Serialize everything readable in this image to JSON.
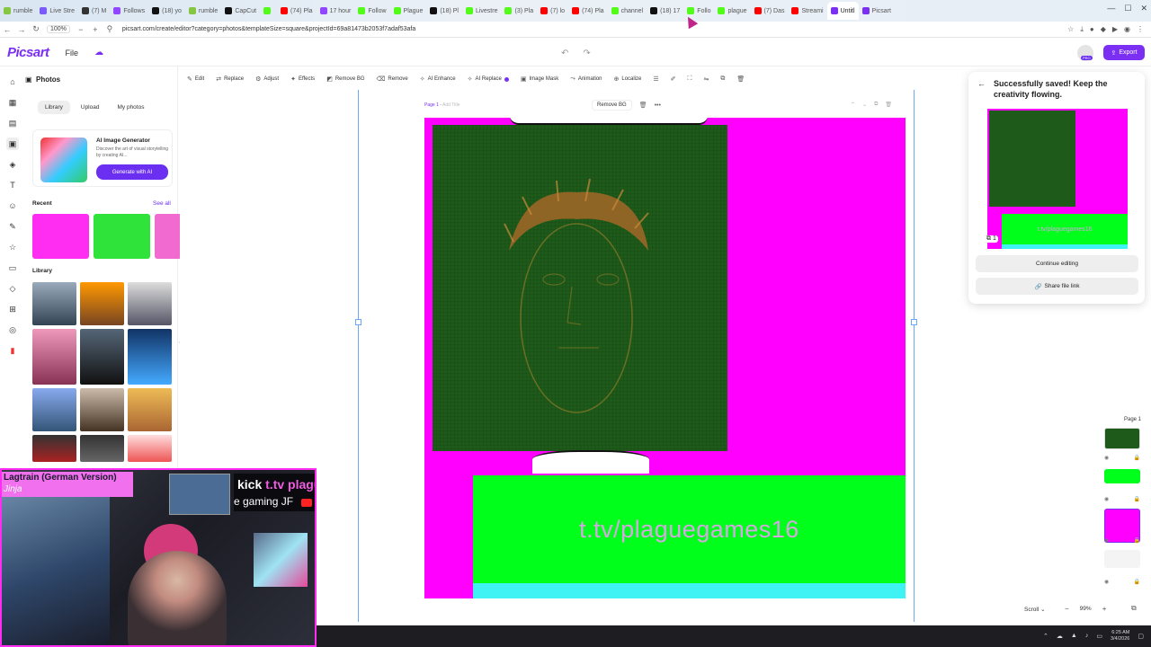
{
  "browser": {
    "tabs": [
      {
        "label": "rumble",
        "color": "#85c742"
      },
      {
        "label": "Live Stre",
        "color": "#7a5af8"
      },
      {
        "label": "(7) M",
        "color": "#333"
      },
      {
        "label": "Follows",
        "color": "#9146ff"
      },
      {
        "label": "(18) yo",
        "color": "#111"
      },
      {
        "label": "rumble",
        "color": "#85c742"
      },
      {
        "label": "CapCut",
        "color": "#111"
      },
      {
        "label": "",
        "color": "#53fc18"
      },
      {
        "label": "(74) Pla",
        "color": "#ff0000"
      },
      {
        "label": "17 hour",
        "color": "#9146ff"
      },
      {
        "label": "Follow",
        "color": "#53fc18"
      },
      {
        "label": "Plague",
        "color": "#53fc18"
      },
      {
        "label": "(18) Pl",
        "color": "#111"
      },
      {
        "label": "Livestre",
        "color": "#53fc18"
      },
      {
        "label": "(3) Pla",
        "color": "#53fc18"
      },
      {
        "label": "(7) lo",
        "color": "#ff0000"
      },
      {
        "label": "(74) Pla",
        "color": "#ff0000"
      },
      {
        "label": "channel",
        "color": "#53fc18"
      },
      {
        "label": "(18) 17",
        "color": "#111"
      },
      {
        "label": "Follo",
        "color": "#53fc18"
      },
      {
        "label": "plague",
        "color": "#53fc18"
      },
      {
        "label": "(7) Das",
        "color": "#ff0000"
      },
      {
        "label": "Streami",
        "color": "#ff0000"
      },
      {
        "label": "Untitl",
        "color": "#7b2ff2",
        "active": true
      },
      {
        "label": "Picsart",
        "color": "#7b2ff2"
      }
    ],
    "zoom": "100%",
    "url": "picsart.com/create/editor?category=photos&templateSize=square&projectId=69a81473b2053f7adaf53afa"
  },
  "app": {
    "logo": "Picsart",
    "file_menu": "File",
    "export_label": "Export",
    "pro_label": "PRO"
  },
  "panel": {
    "title": "Photos",
    "tabs": [
      "Library",
      "Upload",
      "My photos"
    ],
    "ai_card": {
      "title": "AI Image Generator",
      "desc": "Discover the art of visual storytelling by creating AI...",
      "button": "Generate with AI"
    },
    "recent_label": "Recent",
    "see_all": "See all",
    "library_label": "Library"
  },
  "toolbar": {
    "items": [
      {
        "label": "Edit",
        "icon": "edit-icon"
      },
      {
        "label": "Replace",
        "icon": "replace-icon"
      },
      {
        "label": "Adjust",
        "icon": "adjust-icon"
      },
      {
        "label": "Effects",
        "icon": "effects-icon"
      },
      {
        "label": "Remove BG",
        "icon": "remove-bg-icon"
      },
      {
        "label": "Remove",
        "icon": "remove-icon"
      },
      {
        "label": "AI Enhance",
        "icon": "ai-enhance-icon"
      },
      {
        "label": "AI Replace",
        "icon": "ai-replace-icon"
      },
      {
        "label": "Image Mask",
        "icon": "image-mask-icon"
      },
      {
        "label": "Animation",
        "icon": "animation-icon"
      },
      {
        "label": "Localize",
        "icon": "localize-icon"
      }
    ]
  },
  "canvas": {
    "page_label": "Page 1",
    "add_title": "Add Title",
    "remove_bg": "Remove BG",
    "banner_text": "t.tv/plaguegames16",
    "scroll_label": "Scroll",
    "zoom": "99%"
  },
  "popup": {
    "title": "Successfully saved! Keep the creativity flowing.",
    "continue_label": "Continue editing",
    "share_label": "Share file link",
    "preview_text": "t.tv/plaguegames16",
    "copy_count": "1"
  },
  "pages_panel": {
    "label": "Page 1"
  },
  "webcam": {
    "song_title": "Lagtrain (German Version)",
    "song_artist": "Jinja",
    "kick_line1_a": "kick",
    "kick_line1_b": "t.tv plague",
    "kick_line2": "e gaming JF"
  },
  "taskbar": {
    "time": "6:25 AM",
    "date": "3/4/2026"
  },
  "colors": {
    "accent": "#7b2ff2",
    "magenta": "#ff00ff",
    "green": "#00ff1a",
    "cyan": "#3ff3f5"
  }
}
